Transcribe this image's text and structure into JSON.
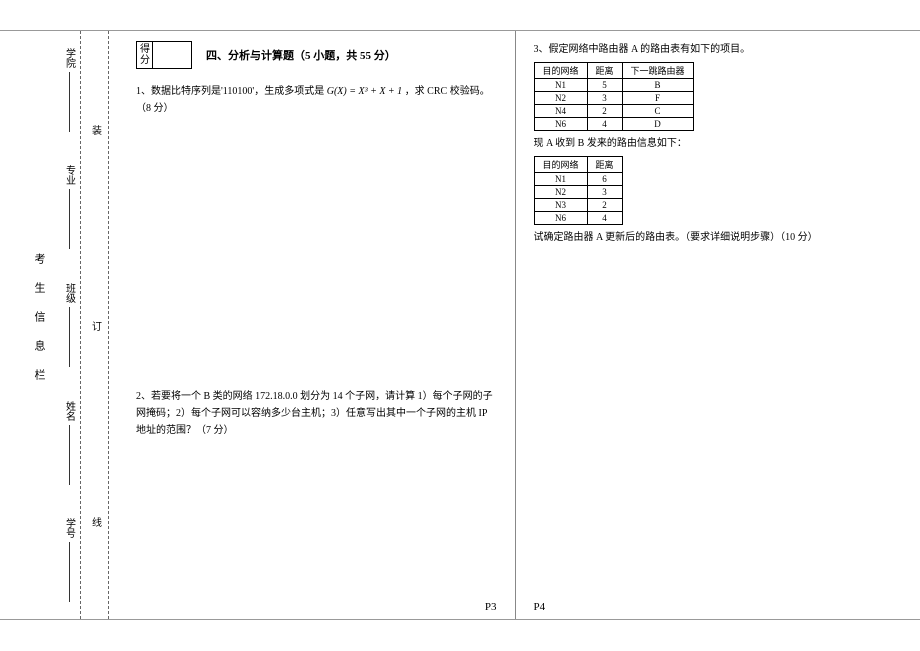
{
  "binding": {
    "title": "考生信息栏",
    "fields": [
      "学院",
      "专业",
      "班级",
      "姓名",
      "学号"
    ],
    "marks": [
      "装",
      "订",
      "线"
    ]
  },
  "left": {
    "score_label_top": "得",
    "score_label_bot": "分",
    "section_title": "四、分析与计算题（5 小题，共 55 分）",
    "q1": {
      "prefix": "1、数据比特序列是'110100'，生成多项式是 ",
      "formula": "G(X) = X³ + X + 1",
      "suffix": "，求 CRC 校验码。（8 分）"
    },
    "q2": "2、若要将一个 B 类的网络 172.18.0.0 划分为 14 个子网，请计算 1）每个子网的子网掩码；2）每个子网可以容纳多少台主机；3）任意写出其中一个子网的主机 IP 地址的范围？（7 分）",
    "pageno": "P3"
  },
  "right": {
    "q3_intro": "3、假定网络中路由器 A 的路由表有如下的项目。",
    "table1_headers": [
      "目的网络",
      "距离",
      "下一跳路由器"
    ],
    "table1_rows": [
      [
        "N1",
        "5",
        "B"
      ],
      [
        "N2",
        "3",
        "F"
      ],
      [
        "N4",
        "2",
        "C"
      ],
      [
        "N6",
        "4",
        "D"
      ]
    ],
    "q3_mid": "现 A 收到 B 发来的路由信息如下：",
    "table2_headers": [
      "目的网络",
      "距离"
    ],
    "table2_rows": [
      [
        "N1",
        "6"
      ],
      [
        "N2",
        "3"
      ],
      [
        "N3",
        "2"
      ],
      [
        "N6",
        "4"
      ]
    ],
    "q3_tail": "试确定路由器 A 更新后的路由表。（要求详细说明步骤）（10 分）",
    "pageno": "P4"
  }
}
